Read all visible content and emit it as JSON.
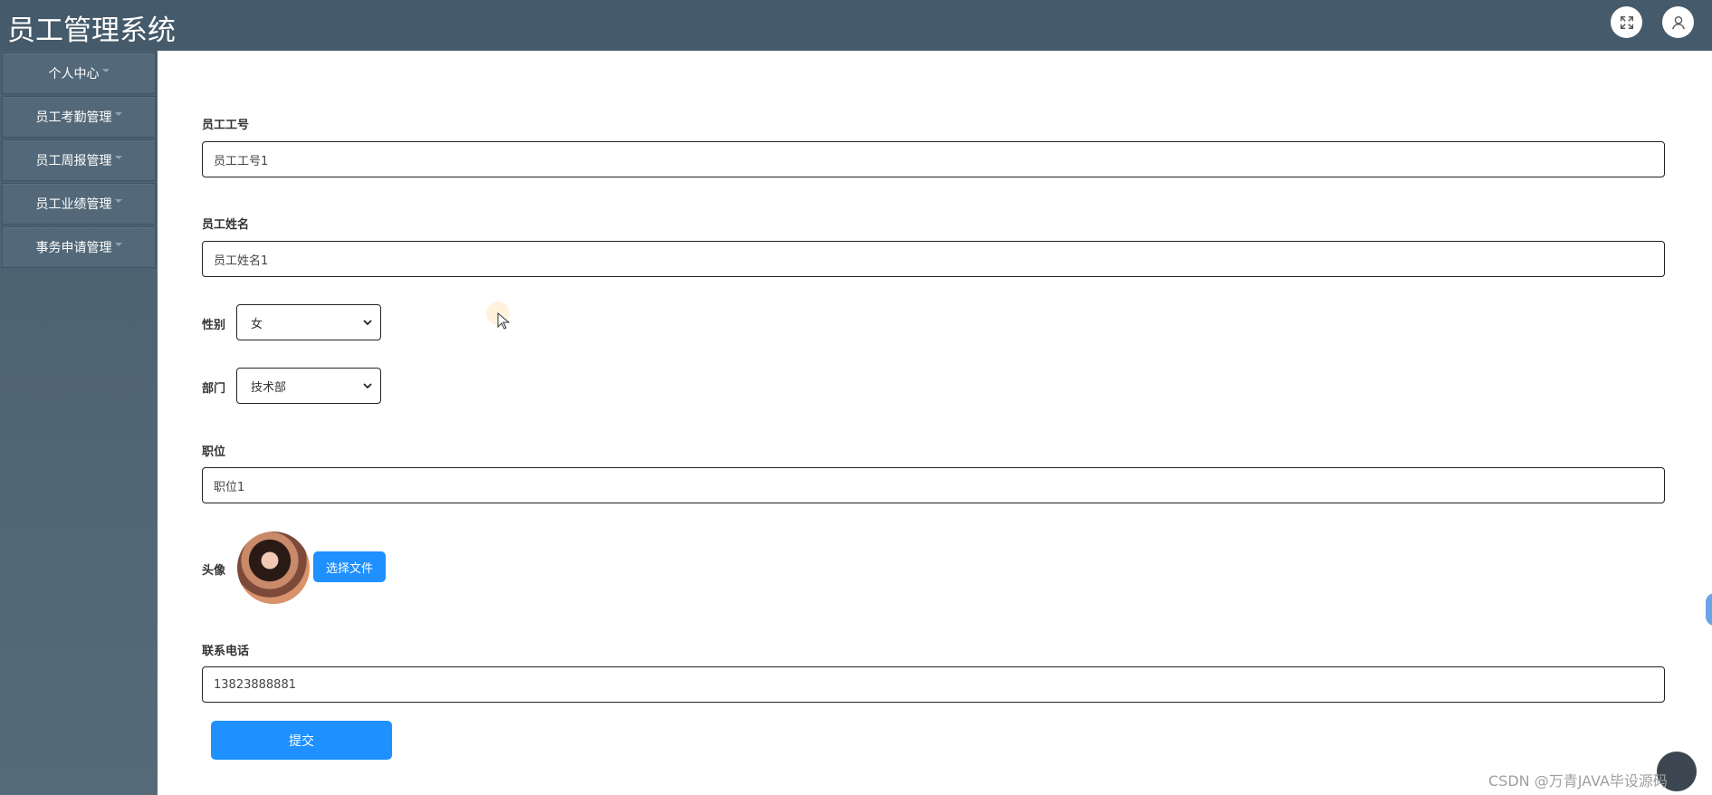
{
  "header": {
    "title": "员工管理系统",
    "fullscreen_icon": "fullscreen-icon",
    "user_icon": "user-icon"
  },
  "sidebar": {
    "items": [
      {
        "label": "个人中心"
      },
      {
        "label": "员工考勤管理"
      },
      {
        "label": "员工周报管理"
      },
      {
        "label": "员工业绩管理"
      },
      {
        "label": "事务申请管理"
      }
    ]
  },
  "form": {
    "employee_no": {
      "label": "员工工号",
      "value": "员工工号1"
    },
    "employee_name": {
      "label": "员工姓名",
      "value": "员工姓名1"
    },
    "gender": {
      "label": "性别",
      "value": "女"
    },
    "department": {
      "label": "部门",
      "value": "技术部"
    },
    "position": {
      "label": "职位",
      "value": "职位1"
    },
    "avatar": {
      "label": "头像",
      "button": "选择文件"
    },
    "phone": {
      "label": "联系电话",
      "value": "13823888881"
    },
    "submit": "提交"
  },
  "watermark": "CSDN @万青JAVA毕设源码",
  "colors": {
    "header_bg": "#455a6a",
    "sidebar_bg": "#53697a",
    "primary": "#1e90ff"
  }
}
